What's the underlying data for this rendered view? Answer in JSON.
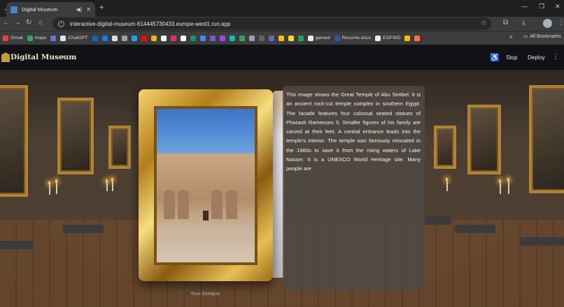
{
  "browser": {
    "tab_title": "Digital Museum",
    "new_tab": "+",
    "url": "interactive-digital-museum-614445730433.europe-west1.run.app",
    "bookmarks": [
      {
        "label": "Gmail",
        "color": "#ea4335"
      },
      {
        "label": "maps",
        "color": "#34a853"
      },
      {
        "label": "",
        "color": "#5b7bd5"
      },
      {
        "label": "ChatGPT",
        "color": "#e5e5e5"
      },
      {
        "label": "",
        "color": "#0a66c2"
      },
      {
        "label": "",
        "color": "#1877f2"
      },
      {
        "label": "",
        "color": "#dddddd"
      },
      {
        "label": "",
        "color": "#9aa0a6"
      },
      {
        "label": "",
        "color": "#1da1f2"
      },
      {
        "label": "",
        "color": "#ff0000"
      },
      {
        "label": "",
        "color": "#f4b400"
      },
      {
        "label": "",
        "color": "#ffffff"
      },
      {
        "label": "",
        "color": "#e1306c"
      },
      {
        "label": "",
        "color": "#ffffff"
      },
      {
        "label": "",
        "color": "#0f9d58"
      },
      {
        "label": "",
        "color": "#4285f4"
      },
      {
        "label": "",
        "color": "#7e57c2"
      },
      {
        "label": "",
        "color": "#a142f4"
      },
      {
        "label": "",
        "color": "#00c4b4"
      },
      {
        "label": "",
        "color": "#34a853"
      },
      {
        "label": "",
        "color": "#9aa0a6"
      },
      {
        "label": "",
        "color": "#616161"
      },
      {
        "label": "",
        "color": "#5c6bc0"
      },
      {
        "label": "",
        "color": "#fbbc04"
      },
      {
        "label": "",
        "color": "#fdd835"
      },
      {
        "label": "",
        "color": "#21a366"
      },
      {
        "label": "gamed",
        "color": "#e8eaed"
      },
      {
        "label": "Resume.docx",
        "color": "#2b579a"
      },
      {
        "label": "EGFWD",
        "color": "#e8eaed"
      },
      {
        "label": "",
        "color": "#fbbc04"
      },
      {
        "label": "",
        "color": "#ff7043"
      }
    ],
    "bookmarks_more": "»",
    "all_bookmarks": "All Bookmarks"
  },
  "app": {
    "brand": "Digital Museum",
    "stop_label": "Stop",
    "deploy_label": "Deploy",
    "menu_icon": "kebab-icon"
  },
  "exhibit": {
    "caption": "Your Antique",
    "description": "This image shows the Great Temple of Abu Simbel. It is an ancient rock-cut temple complex in southern Egypt. The facade features four colossal seated statues of Pharaoh Ramesses II. Smaller figures of his family are carved at their feet. A central entrance leads into the temple's interior. The temple was famously relocated in the 1960s to save it from the rising waters of Lake Nasser. It is a UNESCO World Heritage site. Many people are"
  },
  "colors": {
    "frame_gold": "#c99a3c",
    "panel_bg": "#4f4945",
    "appbar_bg": "#111216"
  }
}
